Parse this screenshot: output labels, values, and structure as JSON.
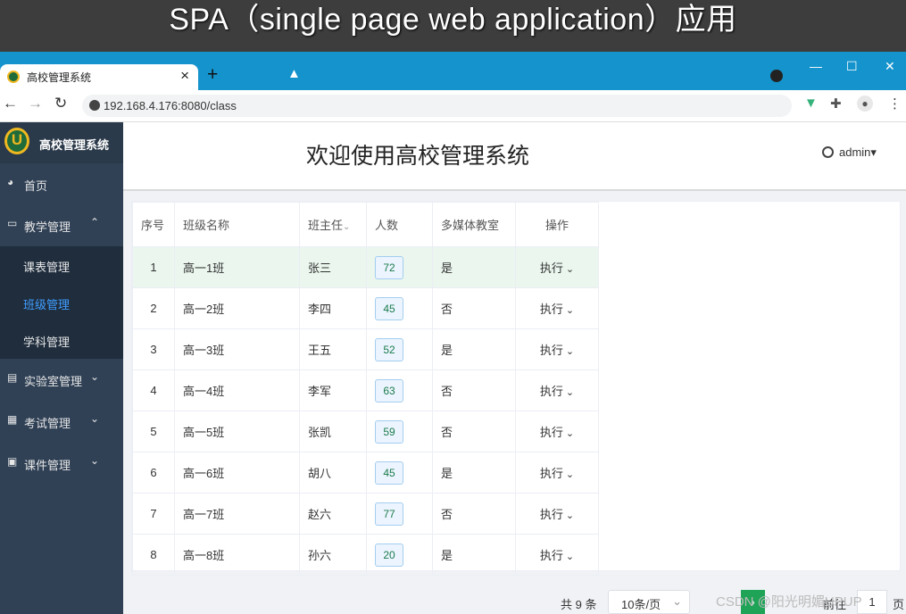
{
  "banner": {
    "text": "SPA（single page web application）应用"
  },
  "browser": {
    "tab_title": "高校管理系统",
    "tab_close": "×",
    "new_tab": "+",
    "url": "192.168.4.176:8080/class",
    "win_min": "—",
    "win_max": "☐",
    "win_close": "✕",
    "back": "←",
    "forward": "→",
    "reload": "↻",
    "menu": "⋮"
  },
  "sidebar": {
    "logo_letter": "U",
    "title": "高校管理系统",
    "items": [
      {
        "label": "首页",
        "icon": "dashboard-icon"
      },
      {
        "label": "教学管理",
        "icon": "monitor-icon",
        "caret": "⌃"
      },
      {
        "label": "实验室管理",
        "icon": "document-icon",
        "caret": "⌄"
      },
      {
        "label": "考试管理",
        "icon": "grid-icon",
        "caret": "⌄"
      },
      {
        "label": "课件管理",
        "icon": "word-icon",
        "caret": "⌄"
      }
    ],
    "submenu": [
      {
        "label": "课表管理",
        "active": false
      },
      {
        "label": "班级管理",
        "active": true
      },
      {
        "label": "学科管理",
        "active": false
      }
    ]
  },
  "header": {
    "title": "欢迎使用高校管理系统",
    "user": "admin"
  },
  "table": {
    "headers": [
      "序号",
      "班级名称",
      "班主任",
      "人数",
      "多媒体教室",
      "操作"
    ],
    "sort_caret": "⌄",
    "action_label": "执行",
    "rows": [
      {
        "no": "1",
        "name": "高一1班",
        "teacher": "张三",
        "count": "72",
        "media": "是"
      },
      {
        "no": "2",
        "name": "高一2班",
        "teacher": "李四",
        "count": "45",
        "media": "否"
      },
      {
        "no": "3",
        "name": "高一3班",
        "teacher": "王五",
        "count": "52",
        "media": "是"
      },
      {
        "no": "4",
        "name": "高一4班",
        "teacher": "李军",
        "count": "63",
        "media": "否"
      },
      {
        "no": "5",
        "name": "高一5班",
        "teacher": "张凯",
        "count": "59",
        "media": "否"
      },
      {
        "no": "6",
        "name": "高一6班",
        "teacher": "胡八",
        "count": "45",
        "media": "是"
      },
      {
        "no": "7",
        "name": "高一7班",
        "teacher": "赵六",
        "count": "77",
        "media": "否"
      },
      {
        "no": "8",
        "name": "高一8班",
        "teacher": "孙六",
        "count": "20",
        "media": "是"
      }
    ]
  },
  "pager": {
    "total": "共 9 条",
    "page_size": "10条/页",
    "next": "›",
    "goto": "前往",
    "page": "1",
    "unit": "页"
  },
  "watermark": "CSDN @阳光明媚UPUP",
  "colors": {
    "sidebar": "#304156",
    "tabbar": "#1593cc",
    "active": "#409eff",
    "highlight_row": "#eaf6ee"
  }
}
